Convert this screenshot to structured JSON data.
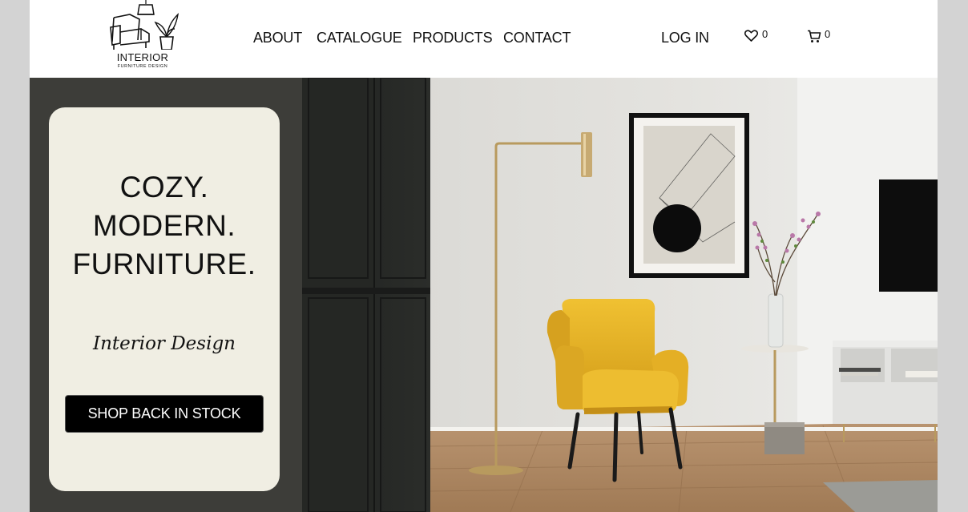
{
  "header": {
    "logo": {
      "title": "INTERIOR",
      "subtitle": "FURNITURE DESIGN"
    },
    "nav": [
      "ABOUT",
      "CATALOGUE",
      "PRODUCTS",
      "CONTACT"
    ],
    "login": "LOG IN",
    "wishlist": {
      "icon": "heart-icon",
      "count": "0"
    },
    "cart": {
      "icon": "cart-icon",
      "count": "0"
    }
  },
  "hero": {
    "headline": [
      "COZY.",
      "MODERN.",
      "FURNITURE."
    ],
    "script": "Interior Design",
    "cta": "SHOP BACK IN STOCK",
    "image_subject": "yellow armchair in a modern living room",
    "colors": {
      "panel_dark": "#3d3d39",
      "card": "#f0eee3",
      "chair": "#e8b528",
      "button": "#000000"
    }
  }
}
